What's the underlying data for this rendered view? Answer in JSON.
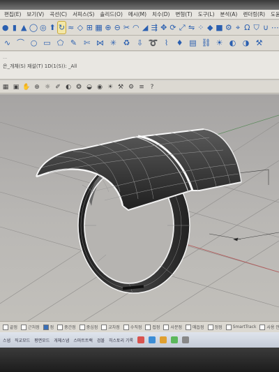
{
  "menu": {
    "items": [
      "편집(E)",
      "보기(V)",
      "곡선(C)",
      "서피스(S)",
      "솔리드(O)",
      "메시(M)",
      "치수(D)",
      "변형(T)",
      "도구(L)",
      "분석(A)",
      "렌더링(R)",
      "도움말(H)"
    ]
  },
  "toolbar1": {
    "icons": [
      "sphere-icon",
      "cylinder-icon",
      "cone-icon",
      "ring-icon",
      "torus-icon",
      "extrude-icon",
      "revolve-icon",
      "sweep-icon",
      "loft-icon",
      "network-icon",
      "patch-icon",
      "boolean-union-icon",
      "boolean-diff-icon",
      "split-icon",
      "fillet-icon",
      "chamfer-icon",
      "offset-icon",
      "move-icon",
      "rotate-icon",
      "scale-icon",
      "mirror-icon",
      "array-icon",
      "gem-icon",
      "cube-icon",
      "gear-icon",
      "target-icon",
      "ring-shape-icon",
      "shield-icon",
      "magnet-icon",
      "dots-icon"
    ]
  },
  "toolbar2": {
    "icons": [
      "curve-icon",
      "arc-icon",
      "circle-icon",
      "rectangle-icon",
      "polygon-icon",
      "curve-edit-icon",
      "trim-icon",
      "join-icon",
      "explode-icon",
      "rebuild-icon",
      "project-icon",
      "flow-icon",
      "pipe-icon",
      "gem-set-icon",
      "stl-icon",
      "chain-icon",
      "render-icon",
      "material-icon",
      "color-icon",
      "settings-icon"
    ]
  },
  "command": {
    "history": "...",
    "prompt": "은_개체(S) 재설(T) 1D(1(S)): _All"
  },
  "viewport_toolbar": {
    "icons": [
      "grid-icon",
      "viewport-icon",
      "pan-icon",
      "zoom-icon",
      "lightbulb-icon",
      "brush-icon",
      "material-icon",
      "color-wheel-icon",
      "shade-icon",
      "sphere-shade-icon",
      "render-icon",
      "settings-icon",
      "gear-icon",
      "layer-icon",
      "help-icon"
    ]
  },
  "status": {
    "snaps": [
      {
        "label": "끝점",
        "on": false
      },
      {
        "label": "근처점",
        "on": false
      },
      {
        "label": "점",
        "on": true
      },
      {
        "label": "중간점",
        "on": false
      },
      {
        "label": "중심점",
        "on": false
      },
      {
        "label": "교차점",
        "on": false
      },
      {
        "label": "수직점",
        "on": false
      },
      {
        "label": "접점",
        "on": false
      },
      {
        "label": "사분점",
        "on": false
      },
      {
        "label": "매듭점",
        "on": false
      },
      {
        "label": "정점",
        "on": false
      },
      {
        "label": "SmartTrack",
        "on": false
      },
      {
        "label": "사용 안 함",
        "on": false
      }
    ]
  },
  "taskbar": {
    "items": [
      "스냅",
      "직교모드",
      "평면모드",
      "개체스냅",
      "스마트트랙",
      "검볼",
      "히스토리 기록"
    ]
  },
  "colors": {
    "viewport_bg": "#b4b2af",
    "ring_face": "#3a3a3a",
    "ring_edge": "#ffffff",
    "accent": "#2a5fb0"
  }
}
